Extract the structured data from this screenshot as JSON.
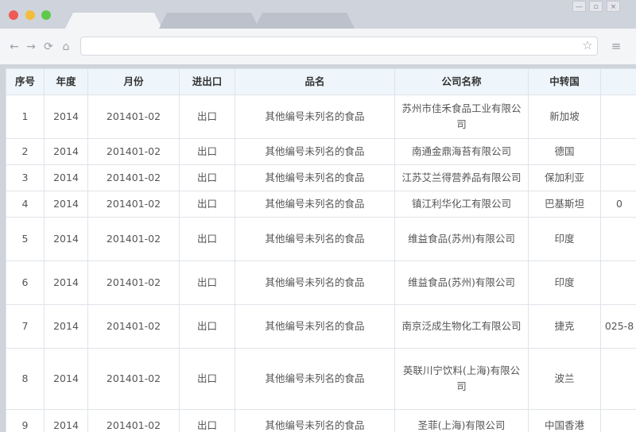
{
  "window": {
    "controls": [
      "close",
      "minimize",
      "zoom"
    ],
    "tabs": [
      {
        "label": ""
      },
      {
        "label": ""
      },
      {
        "label": ""
      }
    ],
    "buttons": {
      "minimize": "—",
      "maximize": "▫",
      "close": "×"
    }
  },
  "toolbar": {
    "back_icon": "←",
    "forward_icon": "→",
    "reload_icon": "⟳",
    "home_icon": "⌂",
    "url": "",
    "star_icon": "☆",
    "menu_icon": "≡"
  },
  "table": {
    "headers": [
      "序号",
      "年度",
      "月份",
      "进出口",
      "品名",
      "公司名称",
      "中转国",
      ""
    ],
    "rows": [
      [
        "1",
        "2014",
        "201401-02",
        "出口",
        "其他编号未列名的食品",
        "苏州市佳禾食品工业有限公司",
        "新加坡",
        ""
      ],
      [
        "2",
        "2014",
        "201401-02",
        "出口",
        "其他编号未列名的食品",
        "南通金鼎海苔有限公司",
        "德国",
        ""
      ],
      [
        "3",
        "2014",
        "201401-02",
        "出口",
        "其他编号未列名的食品",
        "江苏艾兰得营养品有限公司",
        "保加利亚",
        ""
      ],
      [
        "4",
        "2014",
        "201401-02",
        "出口",
        "其他编号未列名的食品",
        "镇江利华化工有限公司",
        "巴基斯坦",
        "0"
      ],
      [
        "5",
        "2014",
        "201401-02",
        "出口",
        "其他编号未列名的食品",
        "维益食品(苏州)有限公司",
        "印度",
        ""
      ],
      [
        "6",
        "2014",
        "201401-02",
        "出口",
        "其他编号未列名的食品",
        "维益食品(苏州)有限公司",
        "印度",
        ""
      ],
      [
        "7",
        "2014",
        "201401-02",
        "出口",
        "其他编号未列名的食品",
        "南京泛成生物化工有限公司",
        "捷克",
        "025-8"
      ],
      [
        "8",
        "2014",
        "201401-02",
        "出口",
        "其他编号未列名的食品",
        "英联川宁饮料(上海)有限公司",
        "波兰",
        ""
      ],
      [
        "9",
        "2014",
        "201401-02",
        "出口",
        "其他编号未列名的食品",
        "圣菲(上海)有限公司",
        "中国香港",
        ""
      ]
    ]
  }
}
